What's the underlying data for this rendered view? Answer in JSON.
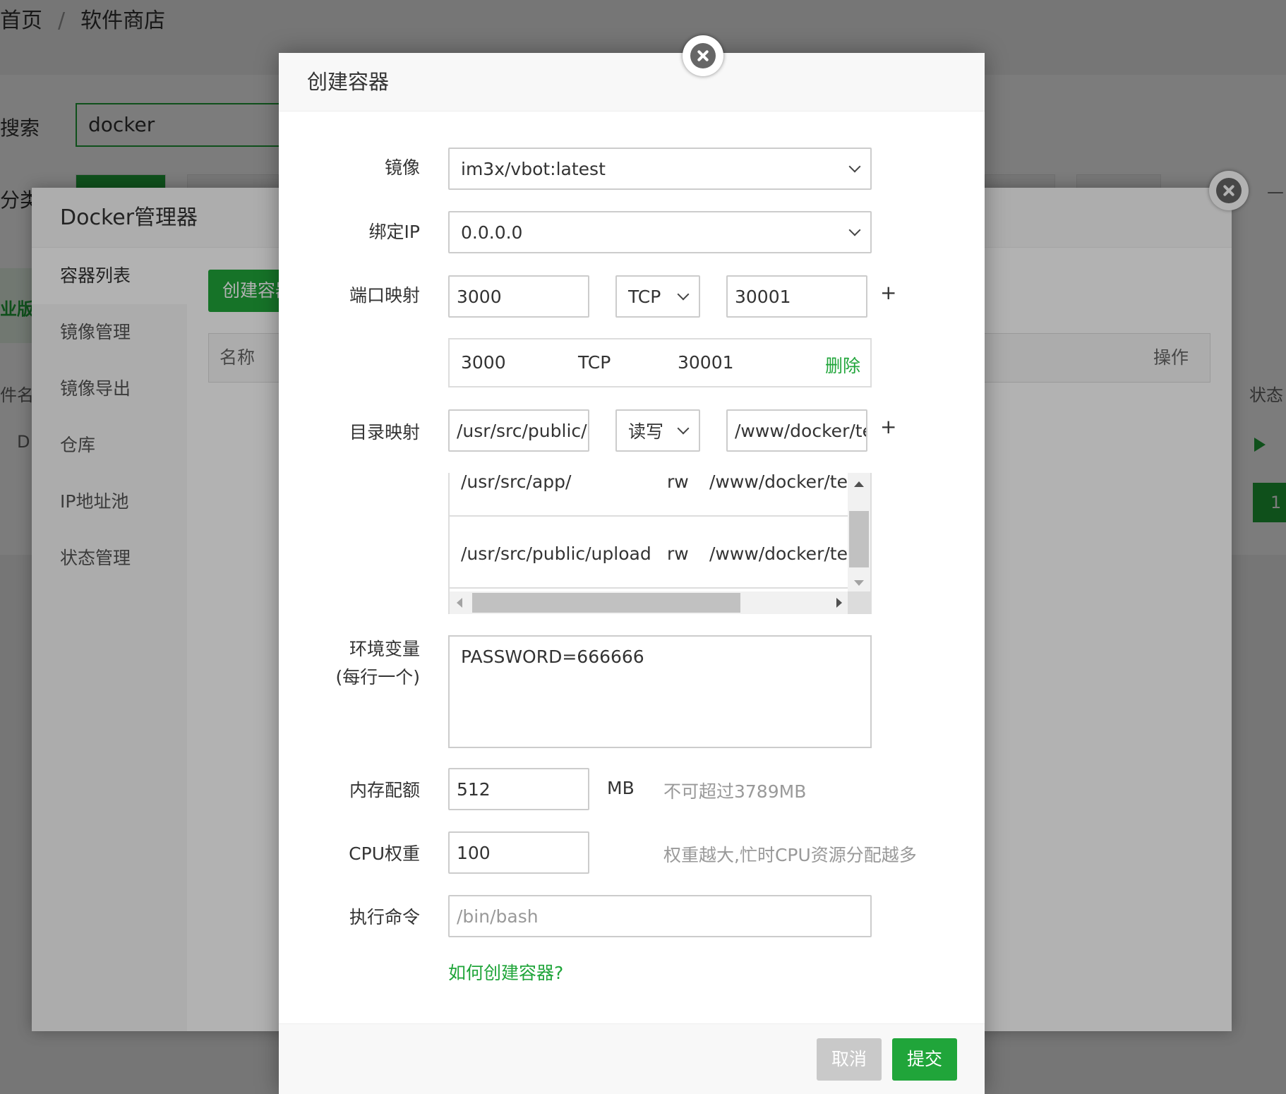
{
  "breadcrumb": {
    "home": "首页",
    "separator": "/",
    "current": "软件商店"
  },
  "bg_page": {
    "search_label": "搜索",
    "search_value": "docker",
    "category_label": "分类",
    "partial_left_texts": [
      "业版",
      "件名称",
      "D"
    ],
    "right_texts": [
      "—",
      "状态"
    ],
    "page_number": "1"
  },
  "docker_manager": {
    "title": "Docker管理器",
    "sidebar": [
      {
        "label": "容器列表"
      },
      {
        "label": "镜像管理"
      },
      {
        "label": "镜像导出"
      },
      {
        "label": "仓库"
      },
      {
        "label": "IP地址池"
      },
      {
        "label": "状态管理"
      }
    ],
    "create_button": "创建容器",
    "table_headers": {
      "name": "名称",
      "operation": "操作"
    }
  },
  "modal": {
    "title": "创建容器",
    "image": {
      "label": "镜像",
      "value": "im3x/vbot:latest"
    },
    "bind_ip": {
      "label": "绑定IP",
      "value": "0.0.0.0"
    },
    "port_mapping": {
      "label": "端口映射",
      "container_port": "3000",
      "protocol": "TCP",
      "host_port": "30001",
      "add": "+",
      "rows": [
        {
          "container": "3000",
          "protocol": "TCP",
          "host": "30001",
          "action": "删除"
        }
      ]
    },
    "dir_mapping": {
      "label": "目录映射",
      "container_dir": "/usr/src/public/upload",
      "mode": "读写",
      "host_dir": "/www/docker/test",
      "add": "+",
      "rows": [
        {
          "container": "/usr/src/app/",
          "mode": "rw",
          "host": "/www/docker/test"
        },
        {
          "container": "/usr/src/public/upload",
          "mode": "rw",
          "host": "/www/docker/test"
        }
      ]
    },
    "env": {
      "label": "环境变量",
      "label_sub": "(每行一个)",
      "value": "PASSWORD=666666"
    },
    "memory": {
      "label": "内存配额",
      "value": "512",
      "unit": "MB",
      "hint": "不可超过3789MB"
    },
    "cpu": {
      "label": "CPU权重",
      "value": "100",
      "hint": "权重越大,忙时CPU资源分配越多"
    },
    "command": {
      "label": "执行命令",
      "placeholder": "/bin/bash"
    },
    "help_link": "如何创建容器?",
    "cancel": "取消",
    "submit": "提交"
  },
  "colors": {
    "accent": "#20a53a",
    "cancel": "#c9c9c9"
  },
  "icons": {
    "close": "close-icon",
    "dropdown": "chevron-down-icon",
    "play": "play-icon"
  }
}
